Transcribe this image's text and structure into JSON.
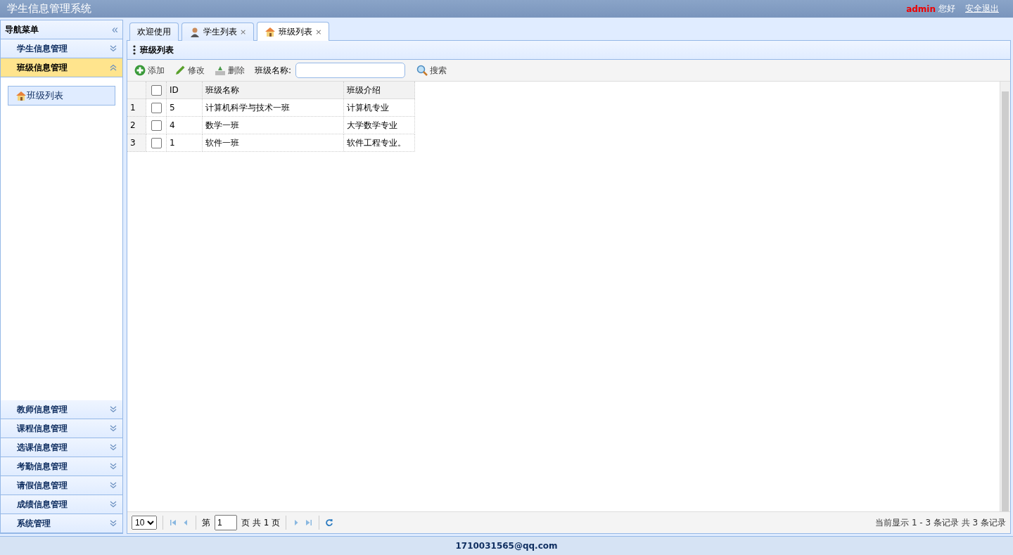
{
  "header": {
    "title": "学生信息管理系统",
    "user": "admin",
    "greeting": "您好",
    "logout": "安全退出"
  },
  "sidebar": {
    "title": "导航菜单",
    "collapse": "«",
    "items": [
      {
        "label": "学生信息管理",
        "expanded": false
      },
      {
        "label": "班级信息管理",
        "expanded": true,
        "children": [
          {
            "label": "班级列表",
            "selected": true
          }
        ]
      },
      {
        "label": "教师信息管理",
        "expanded": false
      },
      {
        "label": "课程信息管理",
        "expanded": false
      },
      {
        "label": "选课信息管理",
        "expanded": false
      },
      {
        "label": "考勤信息管理",
        "expanded": false
      },
      {
        "label": "请假信息管理",
        "expanded": false
      },
      {
        "label": "成绩信息管理",
        "expanded": false
      },
      {
        "label": "系统管理",
        "expanded": false
      }
    ]
  },
  "tabs": [
    {
      "label": "欢迎使用",
      "kind": "text",
      "selected": false
    },
    {
      "label": "学生列表",
      "kind": "person",
      "close": "×",
      "selected": false
    },
    {
      "label": "班级列表",
      "kind": "home",
      "close": "×",
      "selected": true
    }
  ],
  "panel": {
    "title": "班级列表"
  },
  "toolbar": {
    "buttons": [
      {
        "label": "添加",
        "kind": "add"
      },
      {
        "label": "修改",
        "kind": "edit"
      },
      {
        "label": "删除",
        "kind": "delete"
      }
    ],
    "search_label": "班级名称:",
    "search_button": "搜索"
  },
  "table": {
    "header_checked": false,
    "columns": [
      "ID",
      "班级名称",
      "班级介绍"
    ],
    "rows": [
      {
        "number": "1",
        "checked": false,
        "cells": [
          "5",
          "计算机科学与技术一班",
          "计算机专业"
        ]
      },
      {
        "number": "2",
        "checked": false,
        "cells": [
          "4",
          "数学一班",
          "大学数学专业"
        ]
      },
      {
        "number": "3",
        "checked": false,
        "cells": [
          "1",
          "软件一班",
          "软件工程专业。"
        ]
      }
    ]
  },
  "pagination": {
    "page_size": "10",
    "page_prefix": "第",
    "page": "1",
    "page_suffix": "页 共 1 页",
    "info": "当前显示 1 - 3 条记录 共 3 条记录"
  },
  "footer": {
    "email": "1710031565@qq.com"
  }
}
